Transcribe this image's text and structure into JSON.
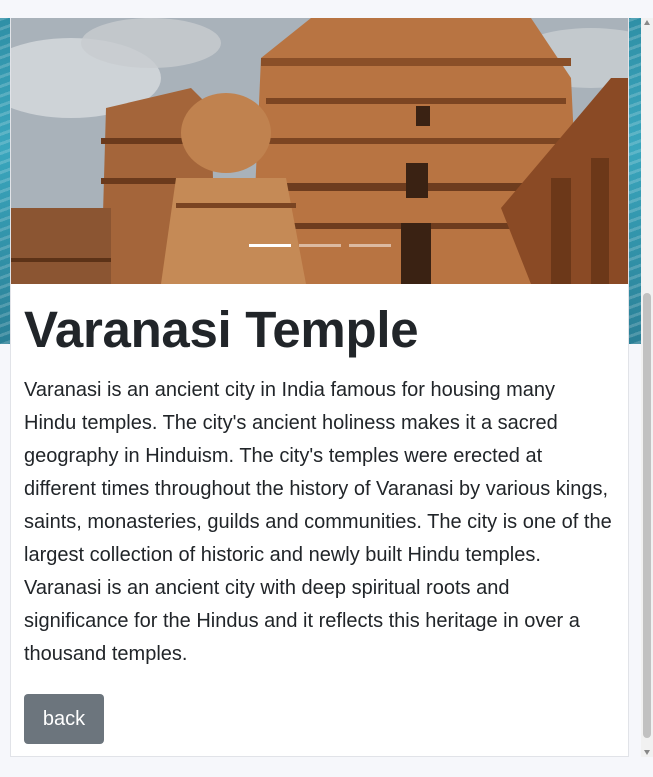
{
  "carousel": {
    "slide_count": 3,
    "active_index": 0,
    "image_alt": "Ancient carved stone temple tower"
  },
  "article": {
    "title": "Varanasi Temple",
    "description": "Varanasi is an ancient city in India famous for housing many Hindu temples. The city's ancient holiness makes it a sacred geography in Hinduism. The city's temples were erected at different times throughout the history of Varanasi by various kings, saints, monasteries, guilds and communities. The city is one of the largest collection of historic and newly built Hindu temples. Varanasi is an ancient city with deep spiritual roots and significance for the Hindus and it reflects this heritage in over a thousand temples."
  },
  "actions": {
    "back_label": "back"
  },
  "colors": {
    "back_button": "#6c757d",
    "text": "#212529",
    "page_bg": "#f6f7fb"
  }
}
